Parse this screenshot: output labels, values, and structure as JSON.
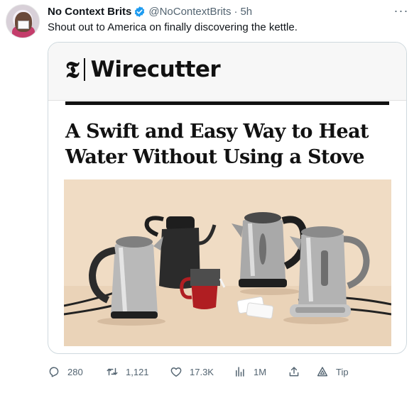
{
  "tweet": {
    "author_name": "No Context Brits",
    "handle": "@NoContextBrits",
    "separator": "·",
    "time": "5h",
    "text": "Shout out to America on finally discovering the kettle.",
    "more_label": "···"
  },
  "card": {
    "logo_t": "𝕿",
    "logo_text": "Wirecutter",
    "headline": "A Swift and Easy Way to Heat Water Without Using a Stove"
  },
  "actions": {
    "replies": "280",
    "retweets": "1,121",
    "likes": "17.3K",
    "views": "1M",
    "tip": "Tip"
  },
  "colors": {
    "verified_badge": "#1d9bf0",
    "secondary_text": "#536471",
    "photo_background": "#f0dcc4"
  },
  "icons": [
    "verified-icon",
    "reply-icon",
    "retweet-icon",
    "like-icon",
    "views-icon",
    "share-icon",
    "tip-icon"
  ]
}
